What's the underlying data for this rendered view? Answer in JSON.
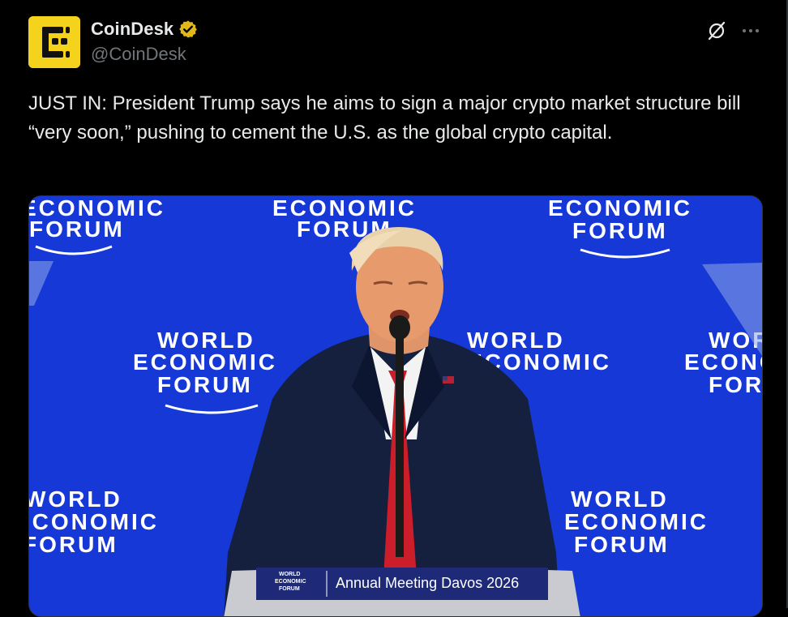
{
  "tweet": {
    "author": {
      "display_name": "CoinDesk",
      "handle": "@CoinDesk",
      "verified": true,
      "avatar_color": "#f5d21c"
    },
    "text": "JUST IN: President Trump says he aims to sign a major crypto market structure bill “very soon,” pushing to cement the U.S. as the global crypto capital.",
    "actions": {
      "grok_icon": "grok-icon",
      "more_icon": "more-dots-icon"
    }
  },
  "media": {
    "backdrop_color": "#1638d6",
    "backdrop_text": {
      "world": "WORLD",
      "economic": "ECONOMIC",
      "forum": "FORUM"
    },
    "podium": {
      "small_logo": [
        "WORLD",
        "ECONOMIC",
        "FORUM"
      ],
      "label": "Annual Meeting Davos 2026"
    }
  },
  "colors": {
    "background": "#000000",
    "text": "#e7e9ea",
    "secondary_text": "#71767b",
    "verified_badge": "#e2b719"
  }
}
